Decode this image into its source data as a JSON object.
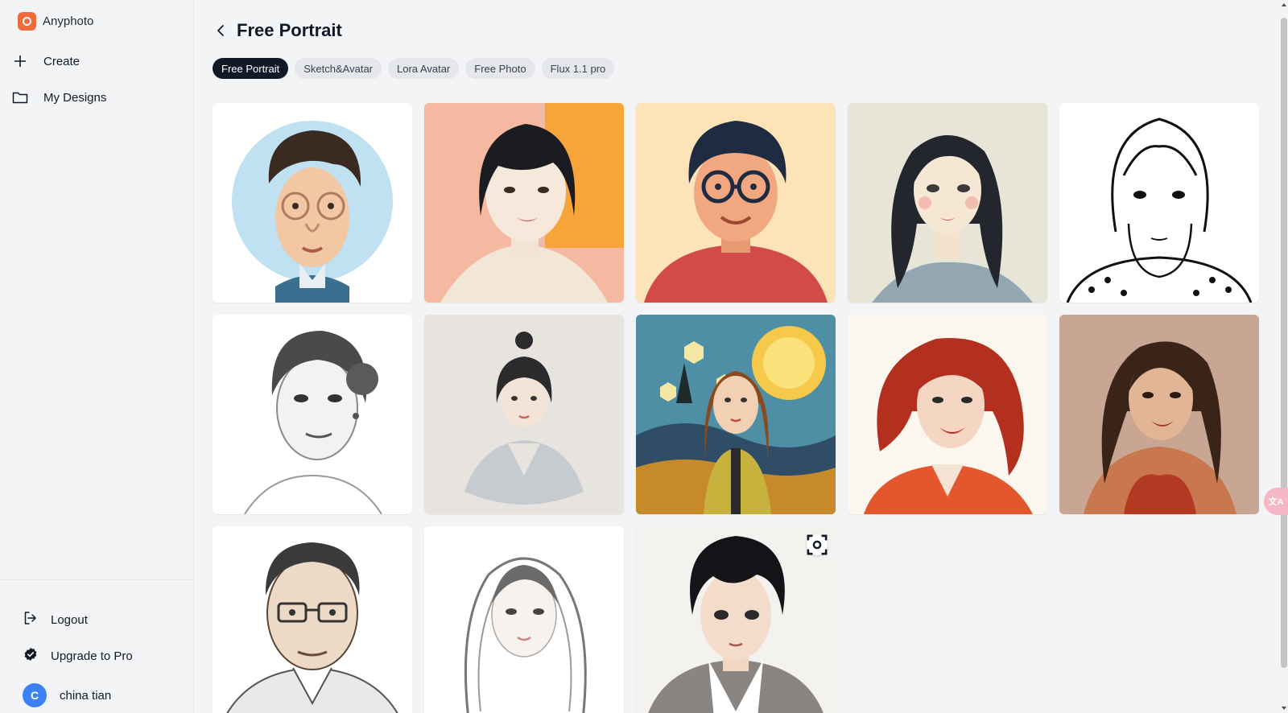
{
  "brand": {
    "name": "Anyphoto",
    "color": "#f06a3b"
  },
  "sidebar": {
    "items": [
      {
        "label": "Create",
        "icon": "plus-icon"
      },
      {
        "label": "My Designs",
        "icon": "folder-icon"
      }
    ],
    "bottom": {
      "logout": "Logout",
      "upgrade": "Upgrade to Pro",
      "user_initial": "C",
      "user_name": "china tian"
    }
  },
  "header": {
    "title": "Free Portrait"
  },
  "tabs": [
    {
      "label": "Free Portrait",
      "active": true
    },
    {
      "label": "Sketch&Avatar",
      "active": false
    },
    {
      "label": "Lora Avatar",
      "active": false
    },
    {
      "label": "Free Photo",
      "active": false
    },
    {
      "label": "Flux 1.1 pro",
      "active": false
    }
  ],
  "gallery": {
    "images": [
      "caricature-glasses-man",
      "bob-hair-woman-orange",
      "flat-man-glasses",
      "flat-woman-long-hair",
      "lineart-bob-girl",
      "pencil-woman-bun",
      "watercolor-girl",
      "starry-night-woman",
      "redhead-woman-splash",
      "brunette-woman-red-dress",
      "sketch-older-man-glasses",
      "sketch-long-hair-woman",
      "anime-boy"
    ],
    "hover_icon": "scan-icon"
  },
  "translate_fab": "文A"
}
